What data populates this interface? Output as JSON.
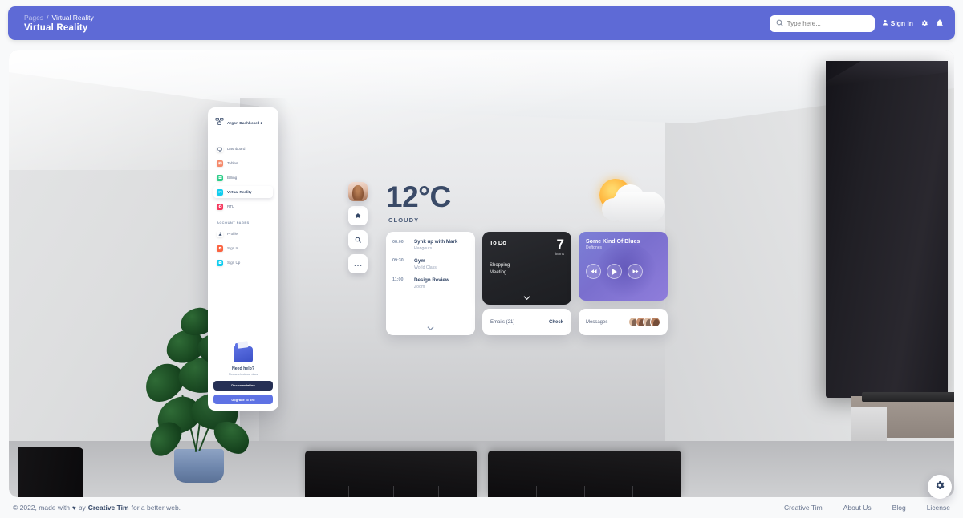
{
  "navbar": {
    "breadcrumb": {
      "root": "Pages",
      "separator": "/",
      "current": "Virtual Reality"
    },
    "title": "Virtual Reality",
    "search": {
      "placeholder": "Type here...",
      "value": "",
      "icon": "search-icon"
    },
    "sign_in_label": "Sign in",
    "icons": {
      "user": "user-icon",
      "settings": "gear-icon",
      "notifications": "bell-icon"
    },
    "background_color": "#5e6ad6"
  },
  "sidebar": {
    "brand": "Argon Dashboard 2",
    "brand_icon": "argon-logo-icon",
    "items": [
      {
        "label": "Dashboard",
        "icon": "desktop-icon",
        "color": "#ffffff",
        "active": false
      },
      {
        "label": "Tables",
        "icon": "table-icon",
        "color": "#f5896a",
        "active": false
      },
      {
        "label": "Billing",
        "icon": "credit-card-icon",
        "color": "#2dce89",
        "active": false
      },
      {
        "label": "Virtual Reality",
        "icon": "vr-icon",
        "color": "#11cdef",
        "active": true
      },
      {
        "label": "RTL",
        "icon": "rtl-icon",
        "color": "#f5365c",
        "active": false
      }
    ],
    "section_label": "ACCOUNT PAGES",
    "account_items": [
      {
        "label": "Profile",
        "icon": "person-icon",
        "color": "#344767",
        "active": false
      },
      {
        "label": "Sign In",
        "icon": "signin-icon",
        "color": "#fb6340",
        "active": false
      },
      {
        "label": "Sign Up",
        "icon": "signup-icon",
        "color": "#11cdef",
        "active": false
      }
    ],
    "help": {
      "icon": "documents-folder-icon",
      "title": "Need help?",
      "subtitle": "Please check our docs",
      "doc_button": "Documentation",
      "pro_button": "Upgrade to pro"
    }
  },
  "toolbar": {
    "avatar": "user-avatar",
    "buttons": [
      {
        "name": "home-icon"
      },
      {
        "name": "search-icon"
      },
      {
        "name": "ellipsis-icon"
      }
    ]
  },
  "weather": {
    "temperature": "12°C",
    "condition": "CLOUDY",
    "icon": "sun-behind-cloud-icon"
  },
  "schedule_card": {
    "events": [
      {
        "time": "08:00",
        "title": "Synk up with Mark",
        "subtitle": "Hangouts"
      },
      {
        "time": "09:30",
        "title": "Gym",
        "subtitle": "World Class"
      },
      {
        "time": "11:00",
        "title": "Design Review",
        "subtitle": "Zoom"
      }
    ],
    "expand_icon": "chevron-down-icon"
  },
  "todo_card": {
    "title": "To Do",
    "count": "7",
    "count_label": "items",
    "items": [
      "Shopping",
      "Meeting"
    ],
    "expand_icon": "chevron-down-icon",
    "background_color": "#232428"
  },
  "music_card": {
    "title": "Some Kind Of Blues",
    "artist": "Deftones",
    "controls": [
      {
        "name": "rewind-button",
        "glyph": "⏪"
      },
      {
        "name": "play-button",
        "glyph": "▶"
      },
      {
        "name": "forward-button",
        "glyph": "⏩"
      }
    ],
    "accent_color": "#7a6fce"
  },
  "emails_card": {
    "label": "Emails (21)",
    "action": "Check"
  },
  "messages_card": {
    "label": "Messages",
    "avatar_count": 4
  },
  "footer": {
    "copyright_prefix": "© 2022, made with",
    "heart": "♥",
    "by": "by",
    "brand": "Creative Tim",
    "suffix": "for a better web.",
    "links": [
      "Creative Tim",
      "About Us",
      "Blog",
      "License"
    ]
  },
  "fab": {
    "icon": "gear-icon"
  }
}
